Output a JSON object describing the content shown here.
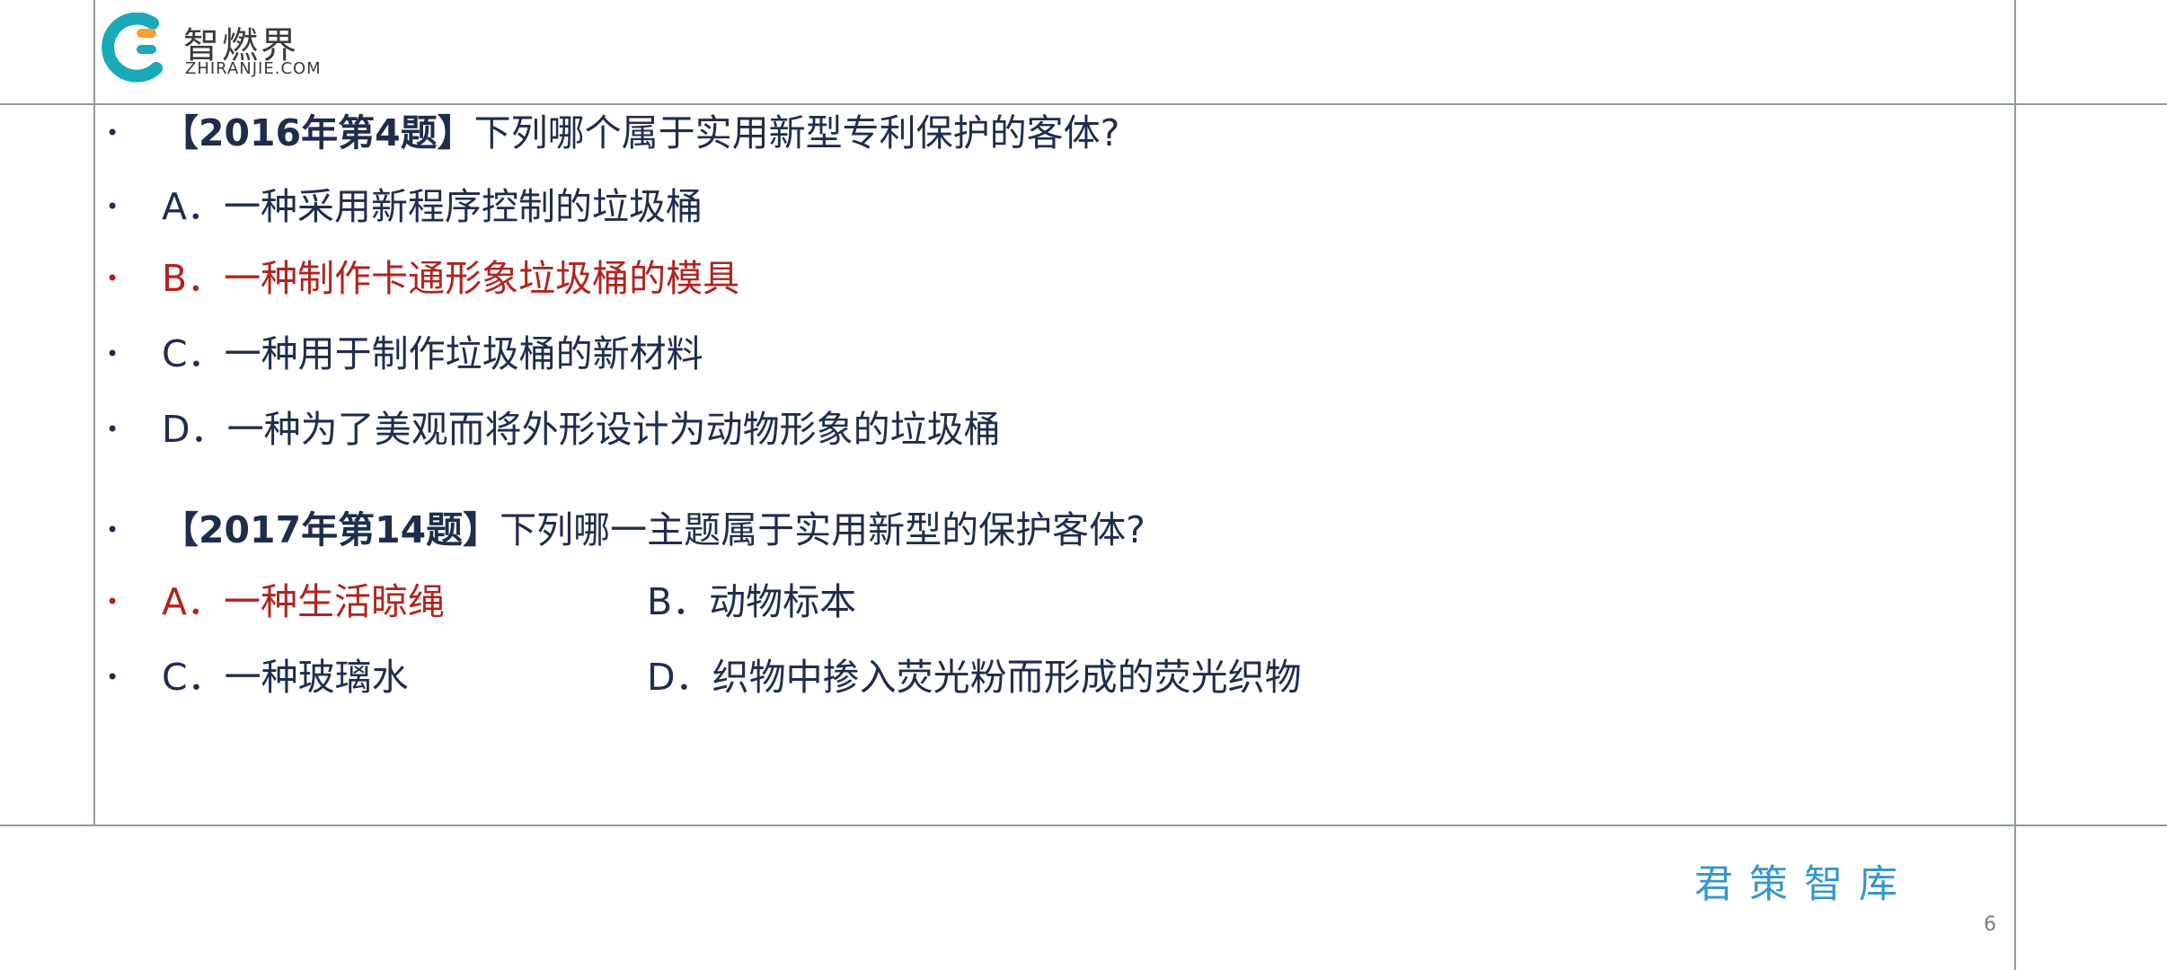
{
  "logo": {
    "cn": "智燃界",
    "en": "ZHIRANJIE.COM"
  },
  "q1": {
    "bracket": "【2016年第4题】",
    "text": "下列哪个属于实用新型专利保护的客体?",
    "options": [
      "A．一种采用新程序控制的垃圾桶",
      "B．一种制作卡通形象垃圾桶的模具",
      "C．一种用于制作垃圾桶的新材料",
      "D．一种为了美观而将外形设计为动物形象的垃圾桶"
    ]
  },
  "q2": {
    "bracket": "【2017年第14题】",
    "text": "下列哪一主题属于实用新型的保护客体?",
    "a": "A．一种生活晾绳",
    "b": "B．动物标本",
    "c": "C．一种玻璃水",
    "d": "D．织物中掺入荧光粉而形成的荧光织物"
  },
  "bullet": "•",
  "brand": "君策智库",
  "page_number": "6",
  "colors": {
    "text": "#1f2d4d",
    "answer": "#b2231f",
    "brand": "#3597c9"
  }
}
